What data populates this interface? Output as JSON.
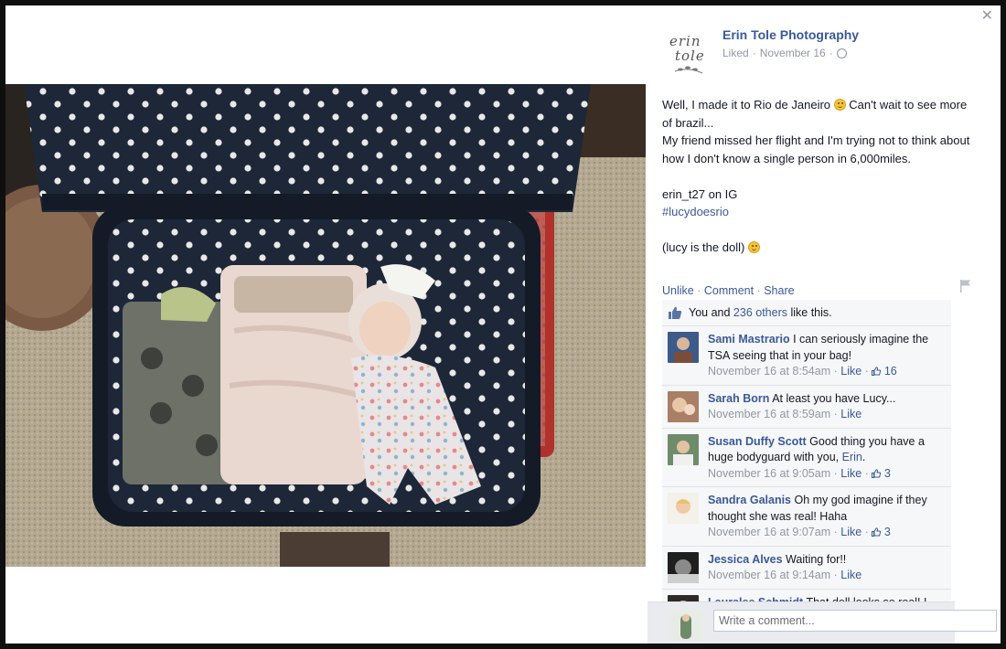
{
  "post": {
    "page_name": "Erin Tole Photography",
    "logo_line1": "erin",
    "logo_line2": "tole",
    "liked": "Liked",
    "date": "November 16",
    "separator": "·",
    "lines": [
      "Well, I made it to Rio de Janeiro",
      "Can't wait to see more of brazil...",
      "My friend missed her flight and I'm trying not to think about how I don't know a single person in 6,000miles.",
      "erin_t27 on IG",
      "#lucydoesrio",
      "(lucy is the doll)"
    ]
  },
  "actions": {
    "unlike": "Unlike",
    "comment": "Comment",
    "share": "Share",
    "dot": "·"
  },
  "likes": {
    "you_and": "You and",
    "others": "236 others",
    "like_this": "like this."
  },
  "comments": [
    {
      "author": "Sami Mastrario",
      "text": "I can seriously imagine the TSA seeing that in your bag!",
      "time": "November 16 at 8:54am",
      "like": "Like",
      "count": "16"
    },
    {
      "author": "Sarah Born",
      "text": "At least you have Lucy...",
      "time": "November 16 at 8:59am",
      "like": "Like",
      "count": ""
    },
    {
      "author": "Susan Duffy Scott",
      "text": "Good thing you have a huge bodyguard with you,",
      "mention": "Erin",
      "text_end": ".",
      "time": "November 16 at 9:05am",
      "like": "Like",
      "count": "3"
    },
    {
      "author": "Sandra Galanis",
      "text": "Oh my god imagine if they thought she was real! Haha",
      "time": "November 16 at 9:07am",
      "like": "Like",
      "count": "3"
    },
    {
      "author": "Jessica Alves",
      "text": "Waiting for!!",
      "time": "November 16 at 9:14am",
      "like": "Like",
      "count": ""
    },
    {
      "author": "Lauralee Schmidt",
      "text": "That doll looks so real! I have to remember each time I see her that",
      "time": "",
      "like": "",
      "count": ""
    }
  ],
  "reply": {
    "placeholder": "Write a comment..."
  },
  "icons": {
    "close": "close-icon",
    "globe": "globe-icon",
    "flag": "flag-icon",
    "thumb": "thumbs-up-icon"
  },
  "colors": {
    "link": "#3b5998",
    "meta": "#9197a3",
    "ufi_bg": "#f6f7f8"
  }
}
